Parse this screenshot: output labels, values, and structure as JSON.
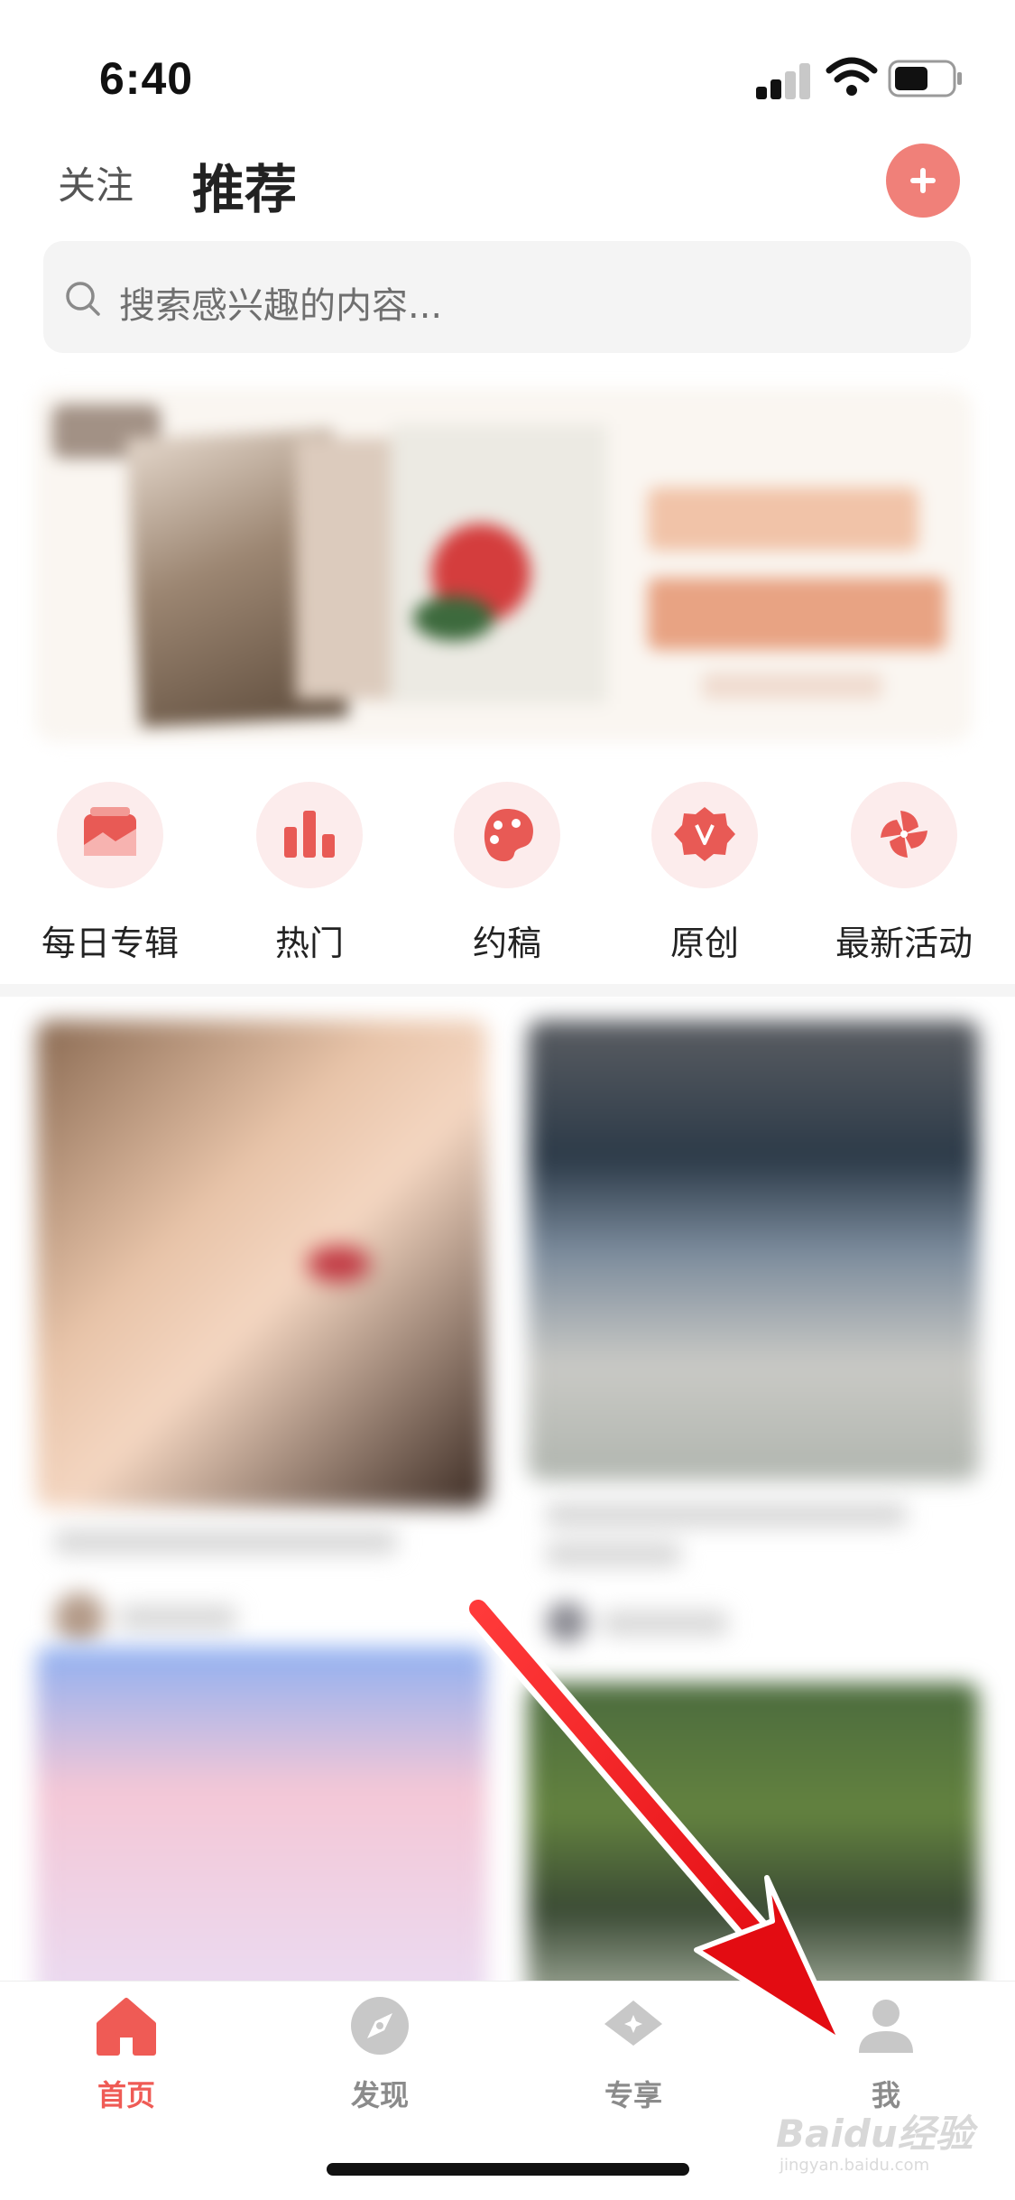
{
  "status_bar": {
    "time": "6:40"
  },
  "header": {
    "tabs": [
      {
        "label": "关注",
        "active": false
      },
      {
        "label": "推荐",
        "active": true
      }
    ],
    "add_icon": "plus-icon"
  },
  "search": {
    "placeholder": "搜索感兴趣的内容..."
  },
  "categories": [
    {
      "label": "每日专辑",
      "icon": "album-icon"
    },
    {
      "label": "热门",
      "icon": "bar-chart-icon"
    },
    {
      "label": "约稿",
      "icon": "palette-icon"
    },
    {
      "label": "原创",
      "icon": "v-badge-icon"
    },
    {
      "label": "最新活动",
      "icon": "pinwheel-icon"
    }
  ],
  "bottom_nav": [
    {
      "label": "首页",
      "icon": "home-icon",
      "active": true
    },
    {
      "label": "发现",
      "icon": "compass-icon",
      "active": false
    },
    {
      "label": "专享",
      "icon": "diamond-icon",
      "active": false
    },
    {
      "label": "我",
      "icon": "person-icon",
      "active": false
    }
  ],
  "watermark": {
    "brand": "Baidu经验",
    "url": "jingyan.baidu.com"
  },
  "colors": {
    "accent": "#ef5b55",
    "category_bg": "#fcecec",
    "arrow": "#e8131a"
  }
}
